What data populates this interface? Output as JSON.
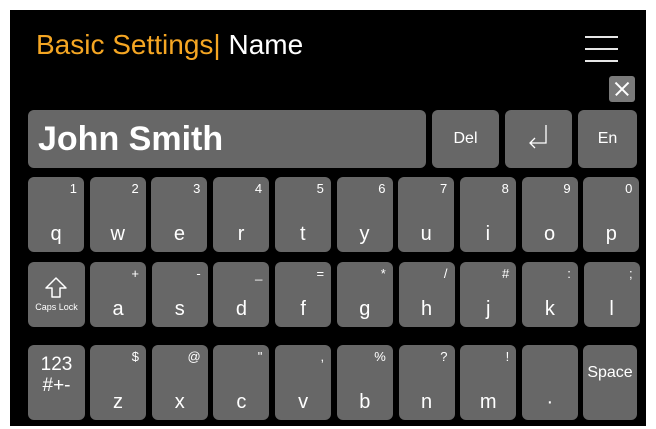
{
  "header": {
    "section_title": "Basic Settings",
    "separator": "|",
    "page_title": "Name"
  },
  "icons": {
    "menu": "hamburger-menu-icon",
    "close": "close-icon",
    "enter": "enter-return-icon",
    "shift": "shift-arrow-icon"
  },
  "input": {
    "value": "John Smith"
  },
  "controls": {
    "delete_label": "Del",
    "language_label": "En",
    "caps_label": "Caps Lock",
    "numeric_label_line1": "123",
    "numeric_label_line2": "#+-",
    "space_label": "Space"
  },
  "keyboard": {
    "row1": [
      {
        "main": "q",
        "sub": "1"
      },
      {
        "main": "w",
        "sub": "2"
      },
      {
        "main": "e",
        "sub": "3"
      },
      {
        "main": "r",
        "sub": "4"
      },
      {
        "main": "t",
        "sub": "5"
      },
      {
        "main": "y",
        "sub": "6"
      },
      {
        "main": "u",
        "sub": "7"
      },
      {
        "main": "i",
        "sub": "8"
      },
      {
        "main": "o",
        "sub": "9"
      },
      {
        "main": "p",
        "sub": "0"
      }
    ],
    "row2": [
      {
        "main": "a",
        "sub": "+"
      },
      {
        "main": "s",
        "sub": "-"
      },
      {
        "main": "d",
        "sub": "_"
      },
      {
        "main": "f",
        "sub": "="
      },
      {
        "main": "g",
        "sub": "*"
      },
      {
        "main": "h",
        "sub": "/"
      },
      {
        "main": "j",
        "sub": "#"
      },
      {
        "main": "k",
        "sub": ":"
      },
      {
        "main": "l",
        "sub": ";"
      }
    ],
    "row3": [
      {
        "main": "z",
        "sub": "$"
      },
      {
        "main": "x",
        "sub": "@"
      },
      {
        "main": "c",
        "sub": "\""
      },
      {
        "main": "v",
        "sub": ","
      },
      {
        "main": "b",
        "sub": "%"
      },
      {
        "main": "n",
        "sub": "?"
      },
      {
        "main": "m",
        "sub": "!"
      },
      {
        "main": "·",
        "sub": ""
      }
    ]
  },
  "colors": {
    "background": "#000000",
    "key": "#676767",
    "accent": "#f5a623",
    "text": "#ffffff"
  }
}
